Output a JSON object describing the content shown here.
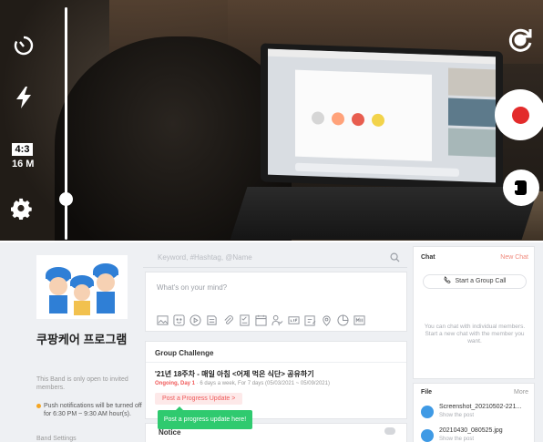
{
  "camera": {
    "aspect_ratio": "4:3",
    "resolution": "16 M",
    "colors": {
      "record": "#e32b2b",
      "controls": "#ffffff"
    }
  },
  "band": {
    "name": "쿠팡케어 프로그램",
    "info": "This Band is only open to invited members.",
    "push_note": "Push notifications will be turned off for 6:30 PM ~ 9:30 AM hour(s).",
    "settings_label": "Band Settings"
  },
  "search": {
    "placeholder": "Keyword, #Hashtag, @Name"
  },
  "composer": {
    "placeholder": "What's on your mind?"
  },
  "challenge": {
    "section_title": "Group Challenge",
    "name": "'21년 18주차 - 매일 아침 <어제 먹은 식단> 공유하기",
    "status": "Ongoing, Day 1",
    "meta": "· 6 days a week, For 7 days (05/03/2021 ~ 05/09/2021)",
    "post_button": "Post a Progress Update >",
    "tooltip": "Post a progress update here!"
  },
  "notice": {
    "title": "Notice"
  },
  "chat": {
    "title": "Chat",
    "new_chat": "New Chat",
    "group_call": "Start a Group Call",
    "hint": "You can chat with individual members. Start a new chat with the member you want."
  },
  "files": {
    "title": "File",
    "more": "More",
    "items": [
      {
        "name": "Screenshot_20210502-221...",
        "sub": "Show the post"
      },
      {
        "name": "20210430_080525.jpg",
        "sub": "Show the post"
      }
    ]
  }
}
